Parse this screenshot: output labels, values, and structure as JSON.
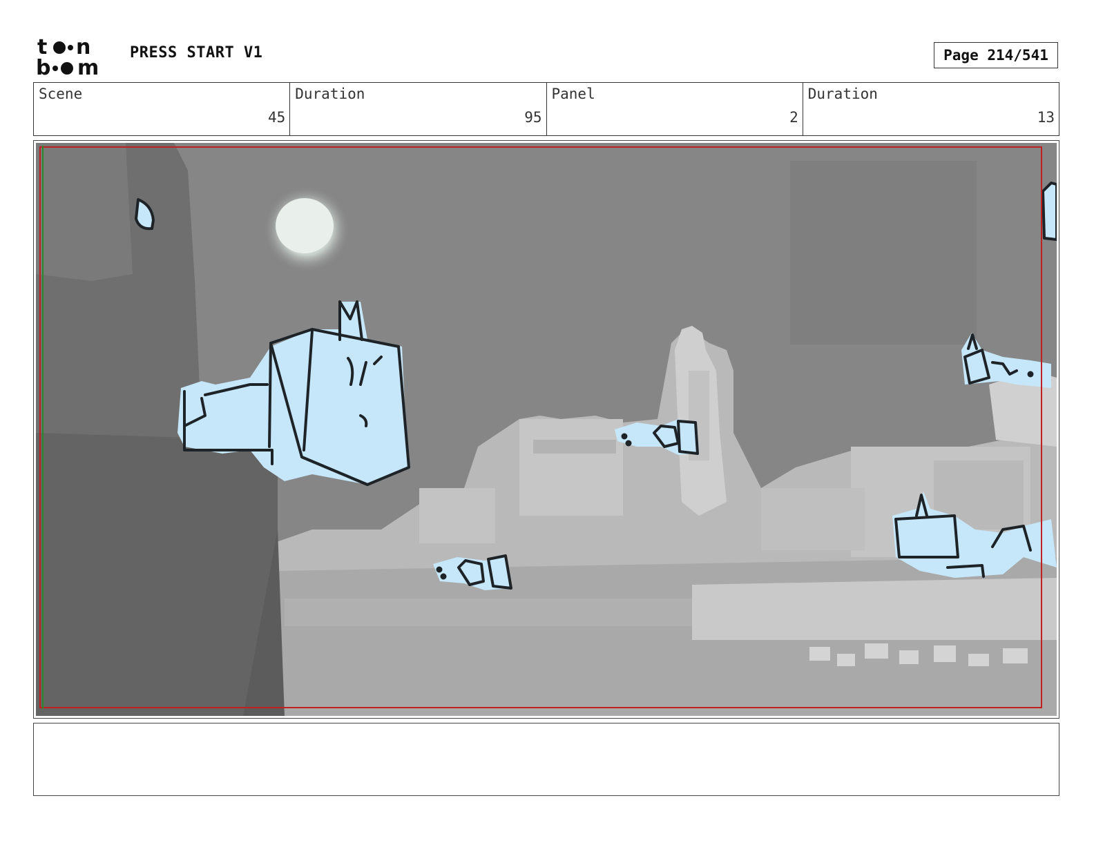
{
  "header": {
    "logo_icon": "toon-boom-logo",
    "project_title": "PRESS START V1",
    "page_label": "Page 214/541"
  },
  "info": {
    "scene_label": "Scene",
    "scene_value": "45",
    "scene_duration_label": "Duration",
    "scene_duration_value": "95",
    "panel_label": "Panel",
    "panel_value": "2",
    "panel_duration_label": "Duration",
    "panel_duration_value": "13"
  },
  "panel": {
    "image_description_icon": "storyboard-sketch-image",
    "colors": {
      "sky": "#8a8a8a",
      "city": "#b8b8b8",
      "sketch_fill": "#c6e7fa",
      "sketch_line": "#1e2327",
      "safe_frame_red": "#c02020",
      "safe_frame_green": "#2a8a2a"
    }
  },
  "notes": {
    "text": ""
  }
}
